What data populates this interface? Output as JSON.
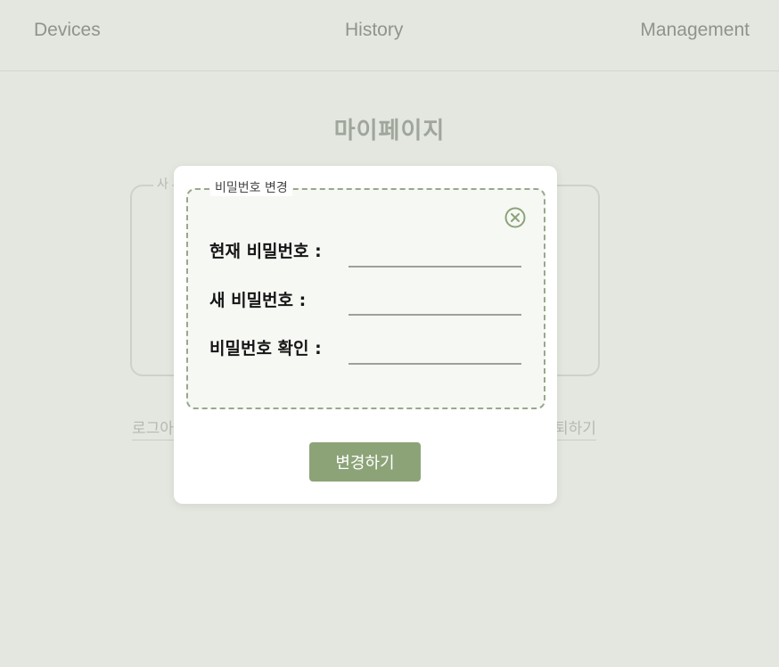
{
  "nav": {
    "devices": "Devices",
    "history": "History",
    "management": "Management"
  },
  "page": {
    "title": "마이페이지",
    "card_legend": "사",
    "link_left": "로그아",
    "link_right": "퇴하기"
  },
  "modal": {
    "legend": "비밀번호 변경",
    "close_icon": "circle-x-icon",
    "fields": [
      {
        "label": "현재 비밀번호 :",
        "value": ""
      },
      {
        "label": "새 비밀번호 :",
        "value": ""
      },
      {
        "label": "비밀번호 확인 :",
        "value": ""
      }
    ],
    "submit_label": "변경하기"
  },
  "colors": {
    "background": "#e4e7e0",
    "accent": "#8ca378",
    "dashed_border": "#98a88c"
  }
}
